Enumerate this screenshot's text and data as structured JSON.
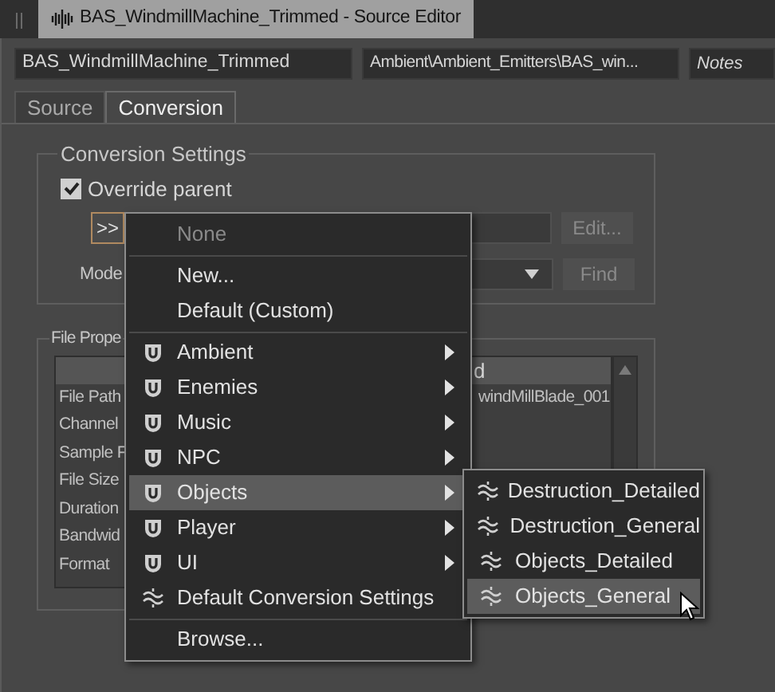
{
  "window": {
    "title": "BAS_WindmillMachine_Trimmed - Source Editor"
  },
  "header": {
    "name": "BAS_WindmillMachine_Trimmed",
    "path": "Ambient\\Ambient_Emitters\\BAS_win...",
    "notes": {
      "placeholder": "Notes"
    }
  },
  "tabs": [
    {
      "label": "Source",
      "selected": false
    },
    {
      "label": "Conversion",
      "selected": true
    }
  ],
  "conversion_settings": {
    "title": "Conversion Settings",
    "override_parent": {
      "label": "Override parent",
      "checked": true
    },
    "browse_button": ">>",
    "edit_button": {
      "label": "Edit...",
      "disabled": true
    },
    "mode_label": "Mode",
    "find_button": {
      "label": "Find",
      "disabled": true
    }
  },
  "file_properties": {
    "title": "File Prope",
    "column_header": "d",
    "rows": [
      {
        "label": "File Path",
        "value": "windMillBlade_001"
      },
      {
        "label": "Channel"
      },
      {
        "label": "Sample F"
      },
      {
        "label": "File Size"
      },
      {
        "label": "Duration"
      },
      {
        "label": "Bandwid"
      },
      {
        "label": "Format"
      }
    ]
  },
  "menu": {
    "items": [
      {
        "kind": "plain",
        "label": "None",
        "disabled": true,
        "selected": false,
        "separator_before": false
      },
      {
        "kind": "plain",
        "label": "New...",
        "disabled": false,
        "selected": false,
        "separator_before": true
      },
      {
        "kind": "plain",
        "label": "Default (Custom)",
        "disabled": false,
        "selected": false,
        "separator_before": false
      },
      {
        "kind": "folder",
        "label": "Ambient",
        "disabled": false,
        "selected": false,
        "separator_before": true
      },
      {
        "kind": "folder",
        "label": "Enemies",
        "disabled": false,
        "selected": false,
        "separator_before": false
      },
      {
        "kind": "folder",
        "label": "Music",
        "disabled": false,
        "selected": false,
        "separator_before": false
      },
      {
        "kind": "folder",
        "label": "NPC",
        "disabled": false,
        "selected": false,
        "separator_before": false
      },
      {
        "kind": "folder",
        "label": "Objects",
        "disabled": false,
        "selected": true,
        "separator_before": false
      },
      {
        "kind": "folder",
        "label": "Player",
        "disabled": false,
        "selected": false,
        "separator_before": false
      },
      {
        "kind": "folder",
        "label": "UI",
        "disabled": false,
        "selected": false,
        "separator_before": false
      },
      {
        "kind": "settings",
        "label": "Default Conversion Settings",
        "disabled": false,
        "selected": false,
        "separator_before": false
      },
      {
        "kind": "plain",
        "label": "Browse...",
        "disabled": false,
        "selected": false,
        "separator_before": true
      }
    ]
  },
  "submenu": {
    "items": [
      {
        "label": "Destruction_Detailed",
        "selected": false
      },
      {
        "label": "Destruction_General",
        "selected": false
      },
      {
        "label": "Objects_Detailed",
        "selected": false
      },
      {
        "label": "Objects_General",
        "selected": true
      }
    ]
  }
}
